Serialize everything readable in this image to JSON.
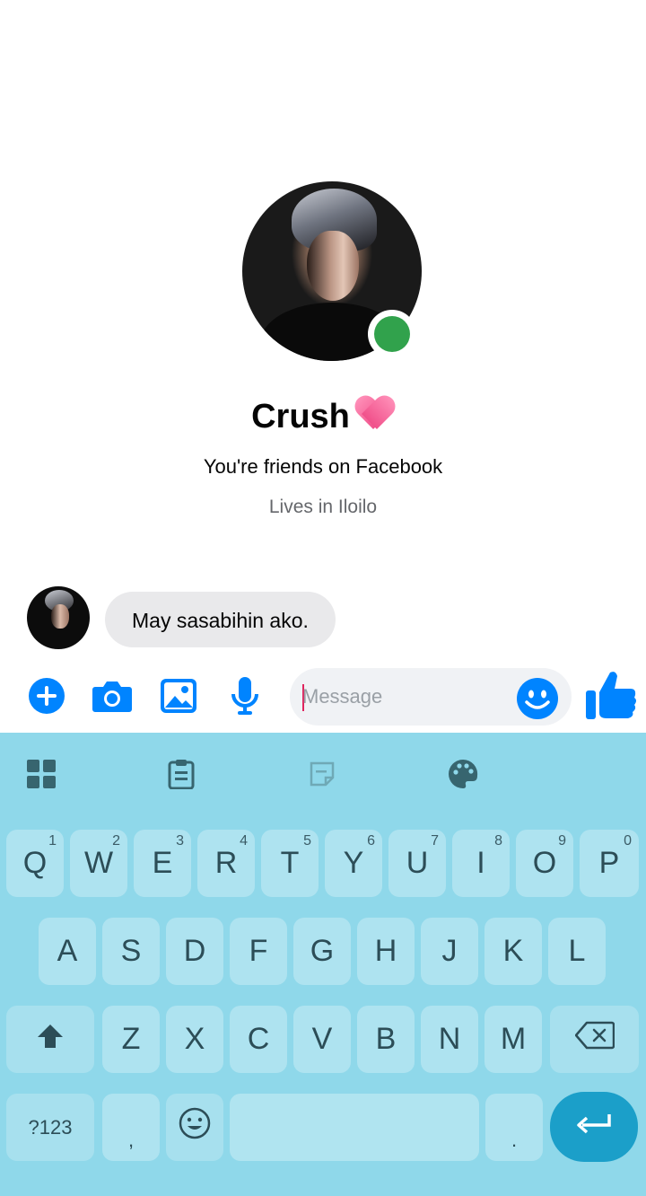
{
  "profile": {
    "name": "Crush",
    "relationship": "You're friends on Facebook",
    "location": "Lives in Iloilo",
    "online_color": "#31a24c"
  },
  "conversation": {
    "messages": [
      {
        "from": "Crush",
        "text": "May sasabihin ako."
      }
    ]
  },
  "composer": {
    "placeholder": "Message",
    "value": "",
    "accent": "#0084ff",
    "icons": [
      "plus-icon",
      "camera-icon",
      "gallery-icon",
      "microphone-icon",
      "emoji-icon",
      "thumbs-up-icon"
    ]
  },
  "keyboard": {
    "background": "#8fd8ea",
    "toolbar_icons": [
      "apps-grid-icon",
      "clipboard-icon",
      "sticker-icon",
      "theme-palette-icon"
    ],
    "row1": [
      {
        "label": "Q",
        "hint": "1"
      },
      {
        "label": "W",
        "hint": "2"
      },
      {
        "label": "E",
        "hint": "3"
      },
      {
        "label": "R",
        "hint": "4"
      },
      {
        "label": "T",
        "hint": "5"
      },
      {
        "label": "Y",
        "hint": "6"
      },
      {
        "label": "U",
        "hint": "7"
      },
      {
        "label": "I",
        "hint": "8"
      },
      {
        "label": "O",
        "hint": "9"
      },
      {
        "label": "P",
        "hint": "0"
      }
    ],
    "row2": [
      "A",
      "S",
      "D",
      "F",
      "G",
      "H",
      "J",
      "K",
      "L"
    ],
    "row3": [
      "Z",
      "X",
      "C",
      "V",
      "B",
      "N",
      "M"
    ],
    "symbols_label": "?123",
    "comma_label": ",",
    "period_label": "."
  }
}
